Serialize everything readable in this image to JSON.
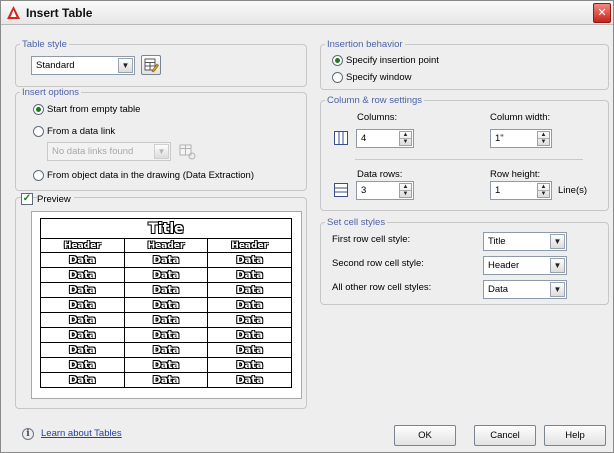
{
  "window": {
    "title": "Insert Table",
    "close_glyph": "✕"
  },
  "table_style": {
    "legend": "Table style",
    "value": "Standard",
    "launch_icon": "table-style-dialog-icon"
  },
  "insert_options": {
    "legend": "Insert options",
    "option_empty": "Start from empty table",
    "option_data_link": "From a data link",
    "data_link_value": "No data links found",
    "option_object_data": "From object data in the drawing (Data Extraction)",
    "selected": "empty"
  },
  "preview": {
    "label": "Preview",
    "checked": true,
    "title": "Title",
    "headers": [
      "Header",
      "Header",
      "Header"
    ],
    "rows": [
      [
        "Data",
        "Data",
        "Data"
      ],
      [
        "Data",
        "Data",
        "Data"
      ],
      [
        "Data",
        "Data",
        "Data"
      ],
      [
        "Data",
        "Data",
        "Data"
      ],
      [
        "Data",
        "Data",
        "Data"
      ],
      [
        "Data",
        "Data",
        "Data"
      ],
      [
        "Data",
        "Data",
        "Data"
      ],
      [
        "Data",
        "Data",
        "Data"
      ],
      [
        "Data",
        "Data",
        "Data"
      ]
    ]
  },
  "insertion_behavior": {
    "legend": "Insertion behavior",
    "option_point": "Specify insertion point",
    "option_window": "Specify window",
    "selected": "point"
  },
  "col_row": {
    "legend": "Column & row settings",
    "columns_label": "Columns:",
    "columns_value": "4",
    "col_width_label": "Column width:",
    "col_width_value": "1\"",
    "data_rows_label": "Data rows:",
    "data_rows_value": "3",
    "row_height_label": "Row height:",
    "row_height_value": "1",
    "row_height_unit": "Line(s)"
  },
  "cell_styles": {
    "legend": "Set cell styles",
    "first_label": "First row cell style:",
    "first_value": "Title",
    "second_label": "Second row cell style:",
    "second_value": "Header",
    "other_label": "All other row cell styles:",
    "other_value": "Data"
  },
  "footer": {
    "info_glyph": "i",
    "learn_link": "Learn about Tables",
    "ok": "OK",
    "cancel": "Cancel",
    "help": "Help"
  },
  "colors": {
    "legend": "#4b62a8",
    "link": "#1f3fa3",
    "accent_red": "#c9231a"
  }
}
